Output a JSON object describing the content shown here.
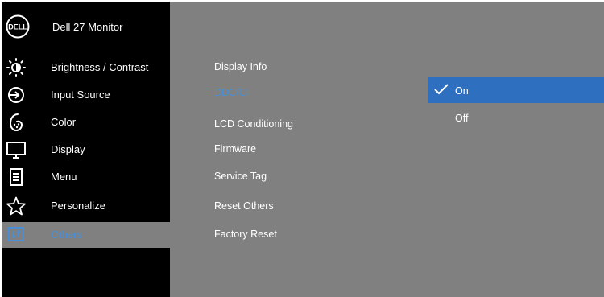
{
  "brand": {
    "logo_text": "DELL",
    "title": "Dell 27 Monitor"
  },
  "sidebar": {
    "items": [
      {
        "label": "Brightness / Contrast",
        "icon": "brightness-icon"
      },
      {
        "label": "Input Source",
        "icon": "input-source-icon"
      },
      {
        "label": "Color",
        "icon": "color-icon"
      },
      {
        "label": "Display",
        "icon": "display-icon"
      },
      {
        "label": "Menu",
        "icon": "menu-icon"
      },
      {
        "label": "Personalize",
        "icon": "star-icon"
      },
      {
        "label": "Others",
        "icon": "others-icon",
        "selected": true
      }
    ]
  },
  "submenu": {
    "items": [
      {
        "label": "Display Info"
      },
      {
        "label": "DDC/CI",
        "active": true
      },
      {
        "label": "LCD Conditioning"
      },
      {
        "label": "Firmware"
      },
      {
        "label": "Service Tag"
      },
      {
        "label": "Reset Others"
      },
      {
        "label": "Factory Reset"
      }
    ]
  },
  "options": {
    "items": [
      {
        "label": "On",
        "selected": true
      },
      {
        "label": "Off"
      }
    ]
  },
  "colors": {
    "accent": "#2f6fbf",
    "active_text": "#4a8fd6",
    "panel": "#808080",
    "sidebar": "#000000"
  }
}
